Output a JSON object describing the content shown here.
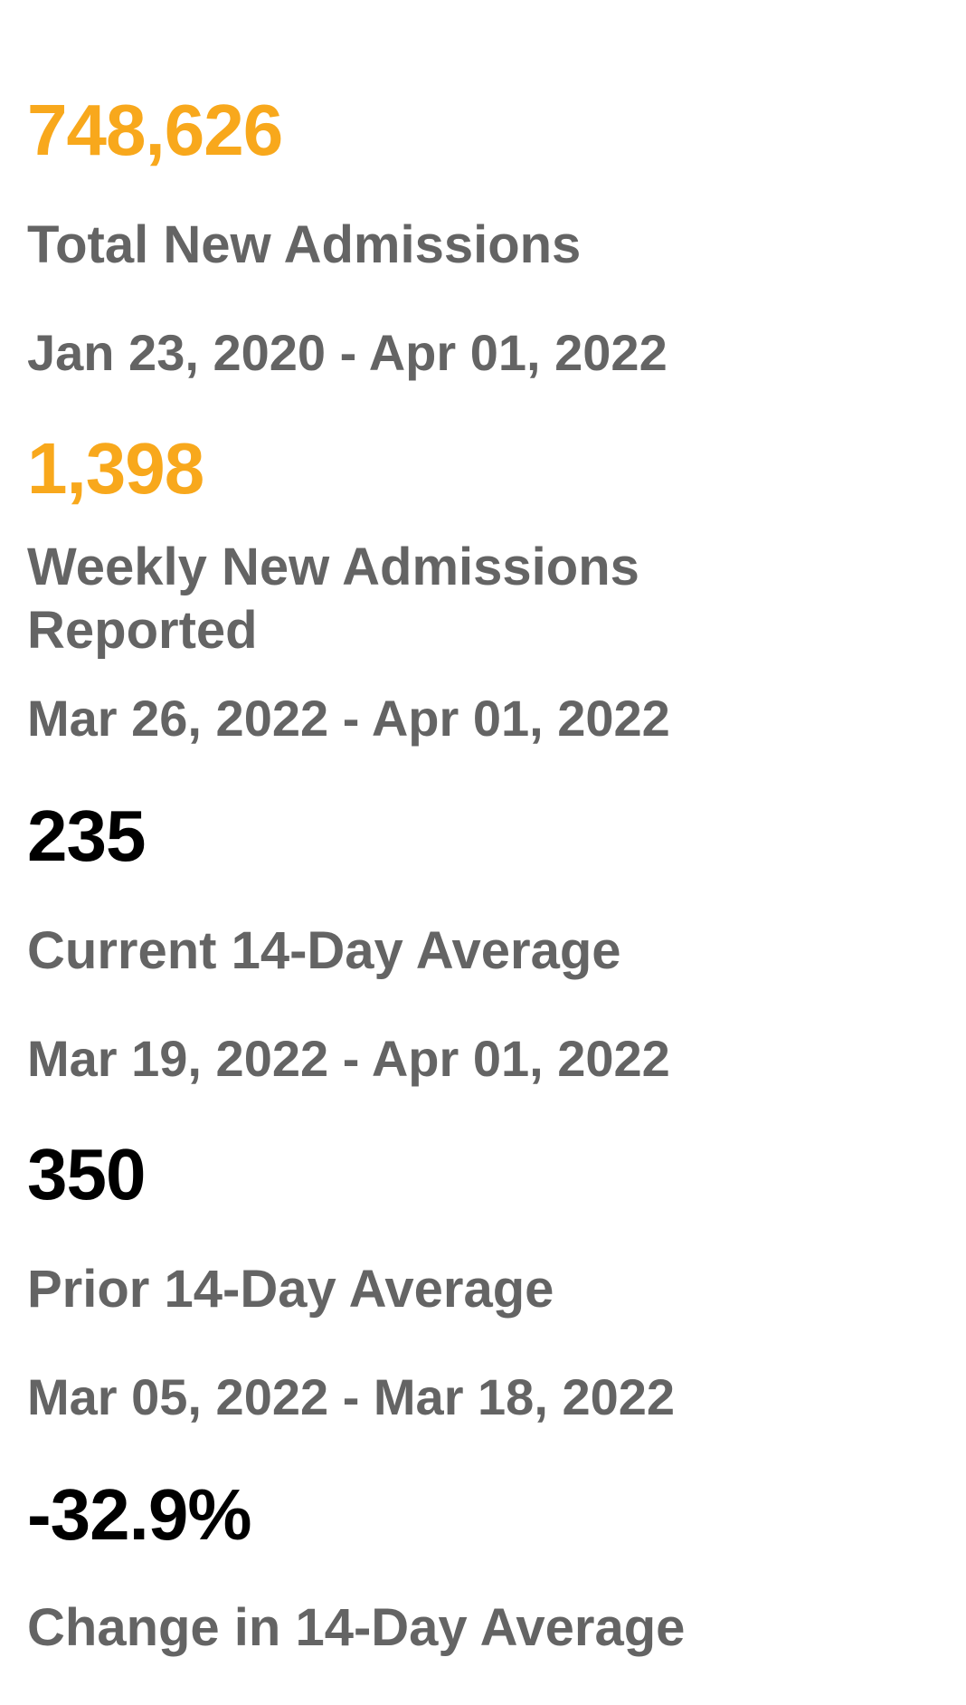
{
  "metrics": {
    "total": {
      "value": "748,626",
      "label": "Total New Admissions",
      "range": "Jan 23, 2020 - Apr 01, 2022"
    },
    "weekly": {
      "value": "1,398",
      "label_line1": "Weekly New Admissions",
      "label_line2": "Reported",
      "range": "Mar 26, 2022 - Apr 01, 2022"
    },
    "current_avg": {
      "value": "235",
      "label": "Current 14-Day Average",
      "range": "Mar 19, 2022 - Apr 01, 2022"
    },
    "prior_avg": {
      "value": "350",
      "label": "Prior 14-Day Average",
      "range": "Mar 05, 2022 - Mar 18, 2022"
    },
    "change": {
      "value": "-32.9%",
      "label": "Change in 14-Day Average"
    }
  },
  "colors": {
    "accent": "#f8a81c",
    "label": "#646464",
    "dark": "#000000"
  }
}
